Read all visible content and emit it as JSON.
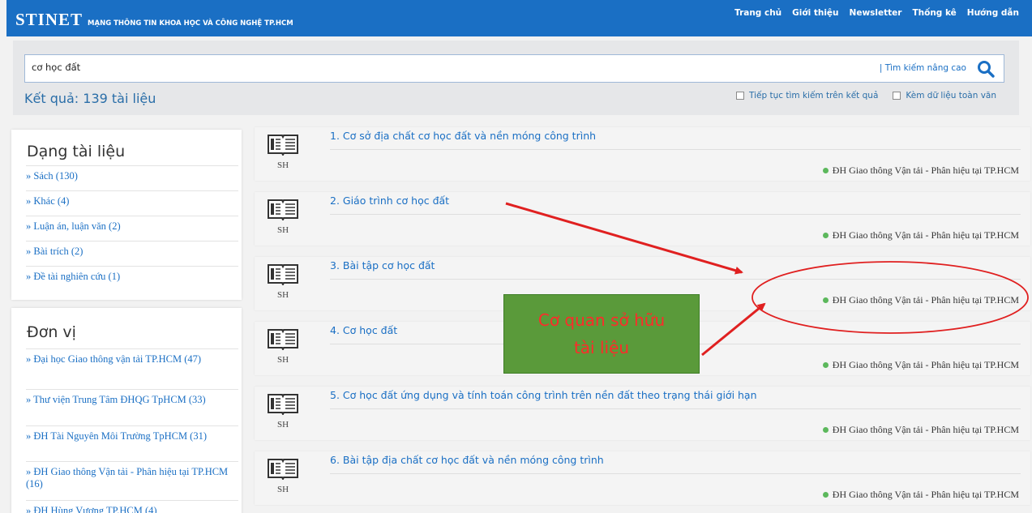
{
  "header": {
    "logo": "STINET",
    "subtitle": "MẠNG THÔNG TIN KHOA HỌC VÀ CÔNG NGHỆ TP.HCM",
    "nav": [
      "Trang chủ",
      "Giới thiệu",
      "Newsletter",
      "Thống kê",
      "Hướng dẫn"
    ],
    "brand_color": "#1a6fc4"
  },
  "search": {
    "query": "cơ học đất",
    "advanced_label": "| Tìm kiếm nâng cao",
    "result_count": "Kết quả: 139 tài liệu",
    "option_search_within": "Tiếp tục tìm kiếm trên kết quả",
    "option_fulltext": "Kèm dữ liệu toàn văn"
  },
  "sidebar": {
    "doc_type_title": "Dạng tài liệu",
    "doc_types": [
      "» Sách (130)",
      "» Khác (4)",
      "» Luận án, luận văn (2)",
      "» Bài trích (2)",
      "» Đề tài nghiên cứu (1)"
    ],
    "unit_title": "Đơn vị",
    "units": [
      "» Đại học Giao thông vận tải TP.HCM (47)",
      "» Thư viện Trung Tâm ĐHQG TpHCM (33)",
      "» ĐH Tài Nguyên Môi Trường TpHCM (31)",
      "» ĐH Giao thông Vận tải - Phân hiệu tại TP.HCM (16)",
      "» ĐH Hùng Vương TP.HCM (4)"
    ]
  },
  "results": [
    {
      "title": "1. Cơ sở địa chất cơ học đất và nền móng công trình",
      "type": "SH",
      "owner": "ĐH Giao thông Vận tải - Phân hiệu tại TP.HCM"
    },
    {
      "title": "2. Giáo trình cơ học đất",
      "type": "SH",
      "owner": "ĐH Giao thông Vận tải - Phân hiệu tại TP.HCM"
    },
    {
      "title": "3. Bài tập cơ học đất",
      "type": "SH",
      "owner": "ĐH Giao thông Vận tải - Phân hiệu tại TP.HCM"
    },
    {
      "title": "4. Cơ học đất",
      "type": "SH",
      "owner": "ĐH Giao thông Vận tải - Phân hiệu tại TP.HCM"
    },
    {
      "title": "5. Cơ học đất ứng dụng và tính toán công trình trên nền đất theo trạng thái giới hạn",
      "type": "SH",
      "owner": "ĐH Giao thông Vận tải - Phân hiệu tại TP.HCM"
    },
    {
      "title": "6. Bài tập địa chất cơ học đất và nền móng công trình",
      "type": "SH",
      "owner": "ĐH Giao thông Vận tải - Phân hiệu tại TP.HCM"
    }
  ],
  "annotation": {
    "callout_line1": "Cơ quan sở hữu",
    "callout_line2": "tài liệu",
    "callout_color": "#5a9a3a",
    "arrow_color": "#e02020"
  }
}
